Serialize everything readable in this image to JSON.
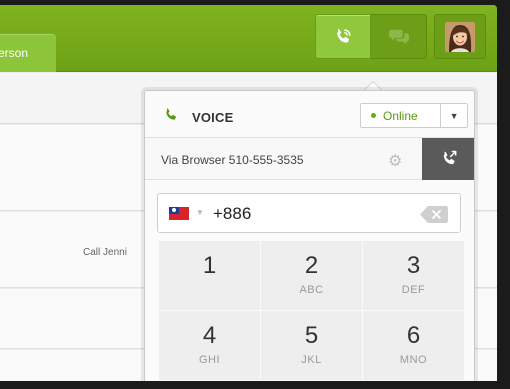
{
  "topbar": {
    "tab_label": "erson",
    "call_button_icon": "phone-icon",
    "chat_button_icon": "chat-icon",
    "accent": "#7fb31f"
  },
  "background": {
    "row_label": "Call Jenni"
  },
  "voice_panel": {
    "title": "VOICE",
    "status": "Online",
    "status_color": "#5fb300",
    "via": "Via Browser 510-555-3535",
    "country_flag": "taiwan-flag",
    "number_value": "+886",
    "keys": [
      {
        "num": "1",
        "letters": ""
      },
      {
        "num": "2",
        "letters": "ABC"
      },
      {
        "num": "3",
        "letters": "DEF"
      },
      {
        "num": "4",
        "letters": "GHI"
      },
      {
        "num": "5",
        "letters": "JKL"
      },
      {
        "num": "6",
        "letters": "MNO"
      }
    ]
  }
}
